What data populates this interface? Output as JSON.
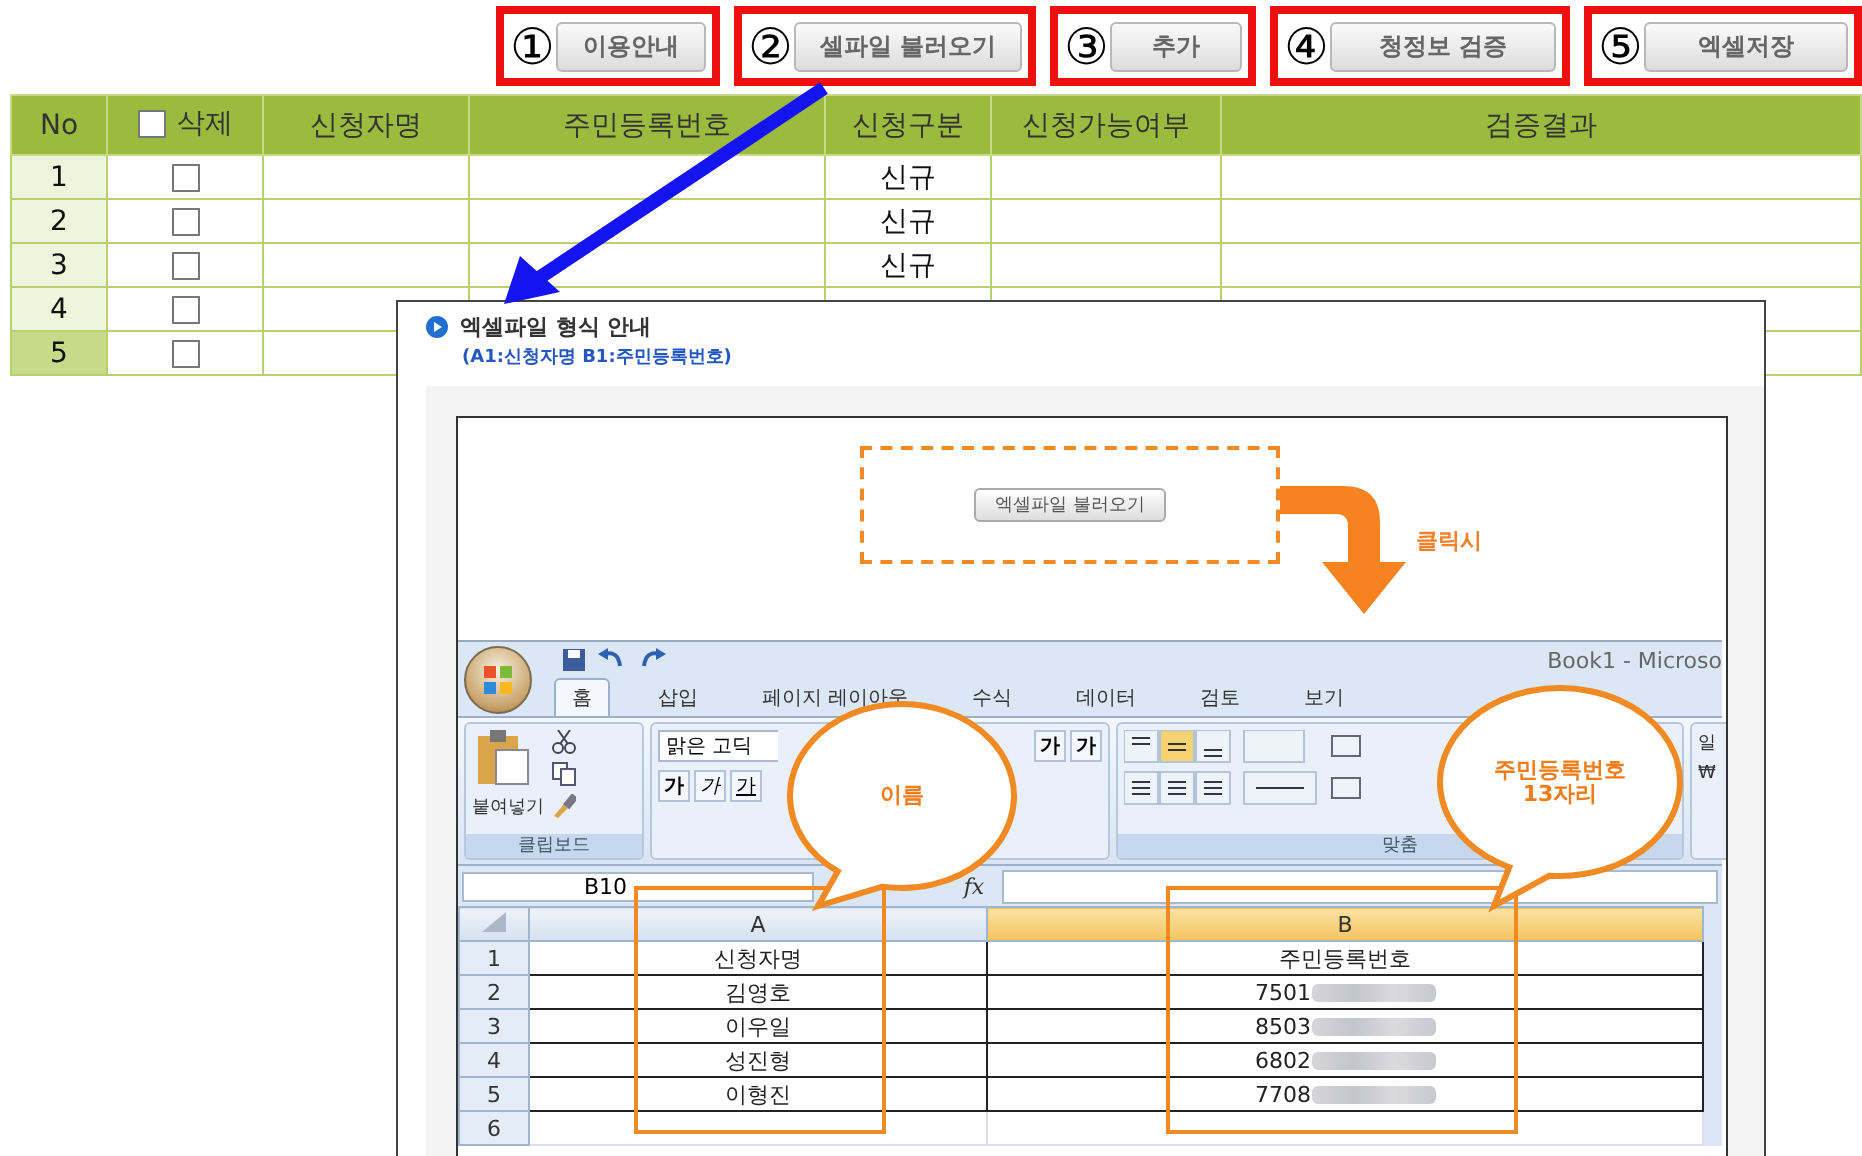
{
  "toolbar": {
    "steps": [
      {
        "number": "①",
        "label": "이용안내"
      },
      {
        "number": "②",
        "label": "셀파일 불러오기"
      },
      {
        "number": "③",
        "label": "추가"
      },
      {
        "number": "④",
        "label": "청정보 검증"
      },
      {
        "number": "⑤",
        "label": "엑셀저장"
      }
    ]
  },
  "table": {
    "columns": [
      "No",
      "삭제",
      "신청자명",
      "주민등록번호",
      "신청구분",
      "신청가능여부",
      "검증결과"
    ],
    "select_all_checked": false,
    "rows": [
      {
        "no": "1",
        "checked": false,
        "type": "신규",
        "highlighted": false
      },
      {
        "no": "2",
        "checked": false,
        "type": "신규",
        "highlighted": false
      },
      {
        "no": "3",
        "checked": false,
        "type": "신규",
        "highlighted": false
      },
      {
        "no": "4",
        "checked": false,
        "highlighted": false
      },
      {
        "no": "5",
        "checked": false,
        "highlighted": true
      }
    ]
  },
  "guide": {
    "title": "엑셀파일 형식 안내",
    "subtitle": "(A1:신청자명  B1:주민등록번호)",
    "demo_button": "엑셀파일 불러오기",
    "click_note": "클릭시",
    "excel": {
      "title": "Book1 - Microso",
      "tabs": [
        {
          "label": "홈",
          "selected": true
        },
        {
          "label": "삽입",
          "selected": false
        },
        {
          "label": "페이지 레이아웃",
          "selected": false
        },
        {
          "label": "수식",
          "selected": false
        },
        {
          "label": "데이터",
          "selected": false
        },
        {
          "label": "검토",
          "selected": false
        },
        {
          "label": "보기",
          "selected": false
        }
      ],
      "paste_label": "붙여넣기",
      "clipboard_group": "클립보드",
      "font_name": "맑은 고딕",
      "font_buttons": [
        "가",
        "가",
        "가"
      ],
      "size_buttons": [
        "가",
        "가"
      ],
      "align_group": "맞춤",
      "number_format": "일",
      "currency": "₩",
      "name_box": "B10",
      "fx": "fx",
      "columns": [
        {
          "label": "A",
          "selected": false
        },
        {
          "label": "B",
          "selected": true
        }
      ],
      "rows": [
        {
          "num": "1",
          "a": "신청자명",
          "b": "주민등록번호",
          "masked": false
        },
        {
          "num": "2",
          "a": "김영호",
          "b": "7501",
          "masked": true
        },
        {
          "num": "3",
          "a": "이우일",
          "b": "8503",
          "masked": true
        },
        {
          "num": "4",
          "a": "성진형",
          "b": "6802",
          "masked": true
        },
        {
          "num": "5",
          "a": "이형진",
          "b": "7708",
          "masked": true
        },
        {
          "num": "6"
        }
      ]
    },
    "bubbles": [
      {
        "lines": [
          "이름"
        ]
      },
      {
        "lines": [
          "주민등록번호",
          "13자리"
        ]
      }
    ]
  }
}
